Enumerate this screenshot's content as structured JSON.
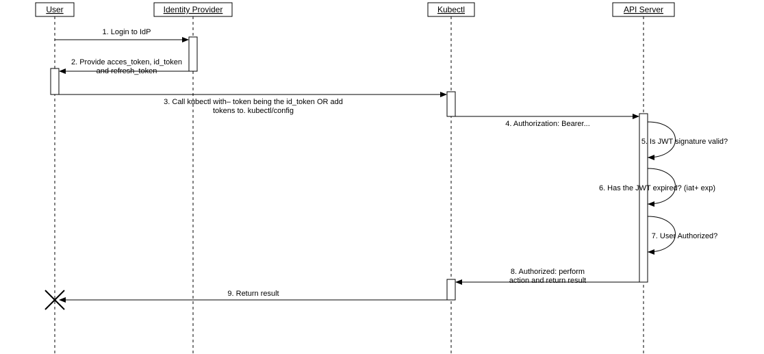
{
  "participants": {
    "user": "User",
    "idp": "Identity Provider",
    "kubectl": "Kubectl",
    "apiserver": "API Server"
  },
  "messages": {
    "m1": "1.  Login to IdP",
    "m2a": "2. Provide acces_token, id_token",
    "m2b": "and refresh_token",
    "m3a": "3.  Call kubectl with– token being the id_token OR add",
    "m3b": "tokens to. kubectl/config",
    "m4": "4.  Authorization: Bearer...",
    "m5": "5. Is JWT signature valid?",
    "m6": "6. Has the JWT expired? (iat+  exp)",
    "m7": "7. User Authorized?",
    "m8a": "8.  Authorized:  perform",
    "m8b": "action and return result",
    "m9": "9. Return result"
  }
}
